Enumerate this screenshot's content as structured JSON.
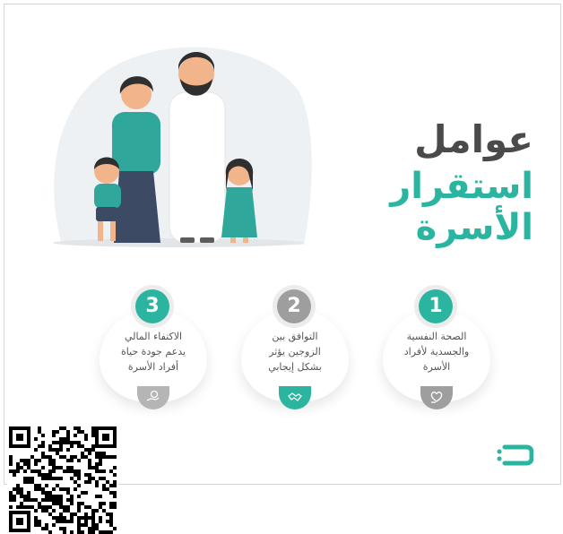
{
  "title": {
    "line1": "عوامل",
    "line2": "استقرار الأسرة"
  },
  "factors": [
    {
      "number": "1",
      "lines": [
        "الصحة النفسية",
        "والجسدية لأفراد",
        "الأسرة"
      ],
      "icon": "heart-hand-icon"
    },
    {
      "number": "2",
      "lines": [
        "التوافق بين",
        "الزوجين يؤثر",
        "بشكل إيجابي"
      ],
      "icon": "handshake-icon"
    },
    {
      "number": "3",
      "lines": [
        "الاكتفاء المالي",
        "يدعم جودة حياة",
        "أفراد الأسرة"
      ],
      "icon": "money-hand-icon"
    }
  ],
  "colors": {
    "accent": "#2bb5a0",
    "title_dark": "#4a4a4a",
    "grey_badge": "#9e9e9e"
  }
}
